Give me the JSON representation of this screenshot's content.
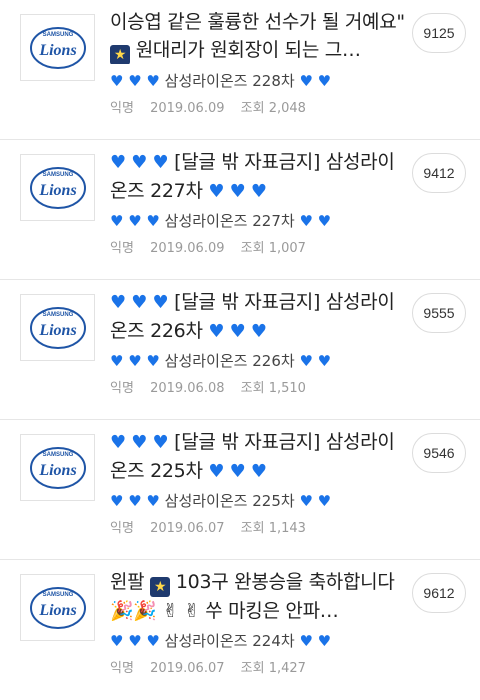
{
  "colors": {
    "heart": "#1a73e8",
    "badge_border": "#dcdcdc",
    "meta": "#9a9a9a"
  },
  "posts": [
    {
      "logo": {
        "top_text": "SAMSUNG",
        "main_text": "Lions"
      },
      "title_text": "이승엽 같은 훌륭한 선수가 될 거예요\" ",
      "title_suffix": "원대리가 원회장이 되는 그…",
      "title_star": true,
      "preview_text": "삼성라이온즈 228차",
      "author": "익명",
      "date": "2019.06.09",
      "views": "조회 2,048",
      "count": "9125"
    },
    {
      "logo": {
        "top_text": "SAMSUNG",
        "main_text": "Lions"
      },
      "title_text": "[달글 밖 자표금지] 삼성라이온즈 227차",
      "preview_text": "삼성라이온즈 227차",
      "author": "익명",
      "date": "2019.06.09",
      "views": "조회 1,007",
      "count": "9412"
    },
    {
      "logo": {
        "top_text": "SAMSUNG",
        "main_text": "Lions"
      },
      "title_text": "[달글 밖 자표금지] 삼성라이온즈 226차",
      "preview_text": "삼성라이온즈 226차",
      "author": "익명",
      "date": "2019.06.08",
      "views": "조회 1,510",
      "count": "9555"
    },
    {
      "logo": {
        "top_text": "SAMSUNG",
        "main_text": "Lions"
      },
      "title_text": "[달글 밖 자표금지] 삼성라이온즈 225차",
      "preview_text": "삼성라이온즈 225차",
      "author": "익명",
      "date": "2019.06.07",
      "views": "조회 1,143",
      "count": "9546"
    },
    {
      "logo": {
        "top_text": "SAMSUNG",
        "main_text": "Lions"
      },
      "title_text": "윈팔",
      "title_mid": "103구 완봉승을 축하합니다",
      "title_end": "쑤 마킹은 안파…",
      "preview_text": "삼성라이온즈 224차",
      "author": "익명",
      "date": "2019.06.07",
      "views": "조회 1,427",
      "count": "9612"
    }
  ]
}
